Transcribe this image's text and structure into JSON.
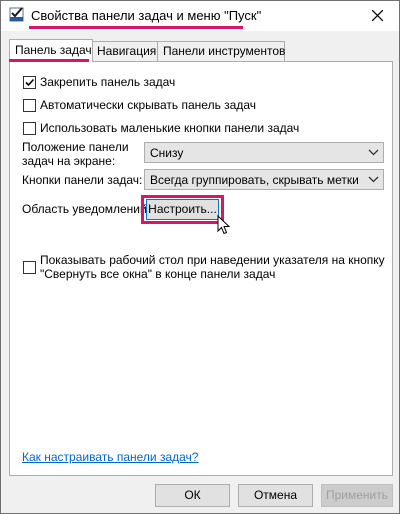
{
  "window": {
    "title": "Свойства панели задач и меню \"Пуск\""
  },
  "tabs": [
    {
      "label": "Панель задач",
      "active": true
    },
    {
      "label": "Навигация",
      "active": false
    },
    {
      "label": "Панели инструментов",
      "active": false
    }
  ],
  "options": {
    "lock_taskbar": {
      "label": "Закрепить панель задач",
      "checked": true
    },
    "auto_hide": {
      "label": "Автоматически скрывать панель задач",
      "checked": false
    },
    "small_buttons": {
      "label": "Использовать маленькие кнопки панели задач",
      "checked": false
    }
  },
  "position": {
    "label_line1": "Положение панели",
    "label_line2": "задач на экране:",
    "value": "Снизу"
  },
  "buttons_mode": {
    "label": "Кнопки панели задач:",
    "value": "Всегда группировать, скрывать метки"
  },
  "notification": {
    "label": "Область уведомлений:",
    "button": "Настроить..."
  },
  "peek": {
    "line1": "Показывать рабочий стол при наведении указателя на кнопку",
    "line2": "\"Свернуть все окна\" в конце панели задач",
    "checked": false
  },
  "help_link": "Как настраивать панели задач?",
  "footer": {
    "ok": "ОК",
    "cancel": "Отмена",
    "apply": "Применить"
  },
  "colors": {
    "highlight": "#d8156a",
    "link": "#0066cc",
    "focus": "#0078d7"
  }
}
